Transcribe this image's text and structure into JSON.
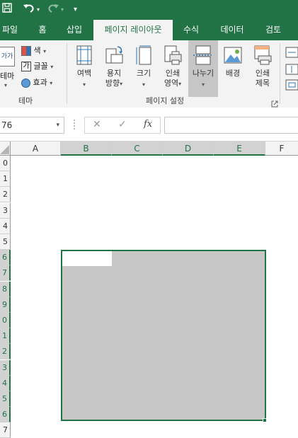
{
  "quick_access": {
    "save_icon": "save-icon",
    "undo_icon": "undo-icon",
    "redo_icon": "redo-icon",
    "customize_icon": "customize-icon"
  },
  "tabs": [
    {
      "label": "파일"
    },
    {
      "label": "홈"
    },
    {
      "label": "삽입"
    },
    {
      "label": "페이지 레이아웃",
      "active": true
    },
    {
      "label": "수식"
    },
    {
      "label": "데이터"
    },
    {
      "label": "검토"
    }
  ],
  "ribbon": {
    "theme_group": {
      "label": "테마",
      "themes_button_label": "테마",
      "themes_icon_text": "가가",
      "colors_label": "색",
      "fonts_label": "글꼴",
      "fonts_icon_text": "가",
      "effects_label": "효과"
    },
    "page_setup_group": {
      "label": "페이지 설정",
      "buttons": [
        {
          "label1": "여백",
          "label2": ""
        },
        {
          "label1": "용지",
          "label2": "방향"
        },
        {
          "label1": "크기",
          "label2": ""
        },
        {
          "label1": "인쇄",
          "label2": "영역"
        },
        {
          "label1": "나누기",
          "label2": ""
        },
        {
          "label1": "배경",
          "label2": ""
        },
        {
          "label1": "인쇄",
          "label2": "제목"
        }
      ],
      "dropdown_arrow": "▾",
      "launcher_icon": "dialog-launcher-icon"
    }
  },
  "formula_bar": {
    "name_box_value": "76",
    "cancel_symbol": "✕",
    "enter_symbol": "✓",
    "fx_symbol": "fx",
    "formula_value": ""
  },
  "grid": {
    "columns": [
      "A",
      "B",
      "C",
      "D",
      "E",
      "F"
    ],
    "selected_columns": [
      "B",
      "C",
      "D",
      "E"
    ],
    "rows": [
      "0",
      "1",
      "2",
      "3",
      "4",
      "5",
      "6",
      "7",
      "8",
      "9",
      "0",
      "1",
      "2",
      "3",
      "4",
      "5",
      "6",
      "7"
    ],
    "selected_rows_from_index": 6,
    "selected_rows_to_index": 16
  },
  "colors": {
    "accent": "#217346",
    "selection_fill": "#c6c6c6",
    "ribbon_bg": "#f3f3f3"
  }
}
